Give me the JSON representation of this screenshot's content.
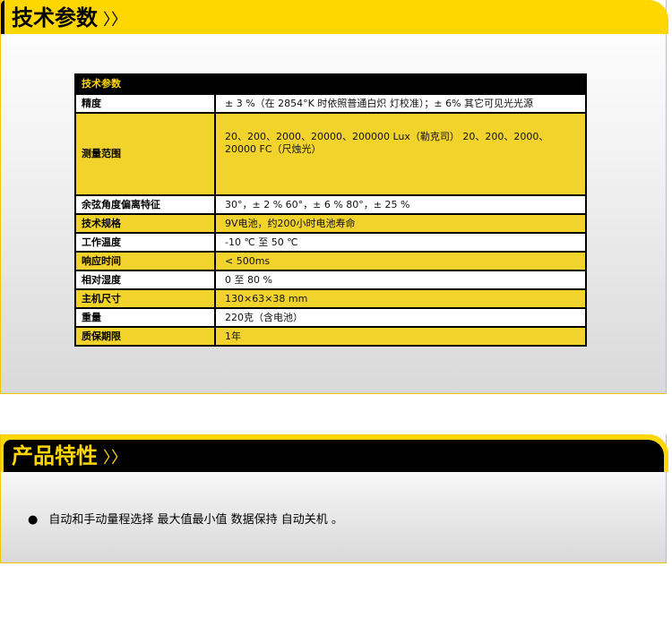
{
  "section1": {
    "title": "技术参数",
    "arrows": "〉〉"
  },
  "spec_table": {
    "header": "技术参数",
    "rows": [
      {
        "label": "精度",
        "value": "± 3 %（在 2854°K 时依照普通白炽 灯校准）；± 6% 其它可见光光源"
      },
      {
        "label": "测量范围",
        "value": "20、200、2000、20000、200000   Lux（勒克司）   20、200、2000、20000 FC（尺烛光）"
      },
      {
        "label": "余弦角度偏离特征",
        "value": "30°，± 2 % 60°，± 6 % 80°，± 25 %"
      },
      {
        "label": "技术规格",
        "value": "9V电池，约200小时电池寿命"
      },
      {
        "label": "工作温度",
        "value": "-10 ℃ 至 50 ℃"
      },
      {
        "label": "响应时间",
        "value": "< 500ms"
      },
      {
        "label": "相对湿度",
        "value": "0 至 80 %"
      },
      {
        "label": "主机尺寸",
        "value": "130×63×38 mm"
      },
      {
        "label": "重量",
        "value": "220克（含电池）"
      },
      {
        "label": "质保期限",
        "value": "1年"
      }
    ]
  },
  "section2": {
    "title": "产品特性",
    "arrows": "〉〉"
  },
  "features": {
    "bullet": "●",
    "text": "自动和手动量程选择 最大值最小值 数据保持 自动关机 。"
  },
  "colors": {
    "yellow": "#ffd700",
    "cell_yellow": "#f2d32c",
    "black": "#000000"
  }
}
